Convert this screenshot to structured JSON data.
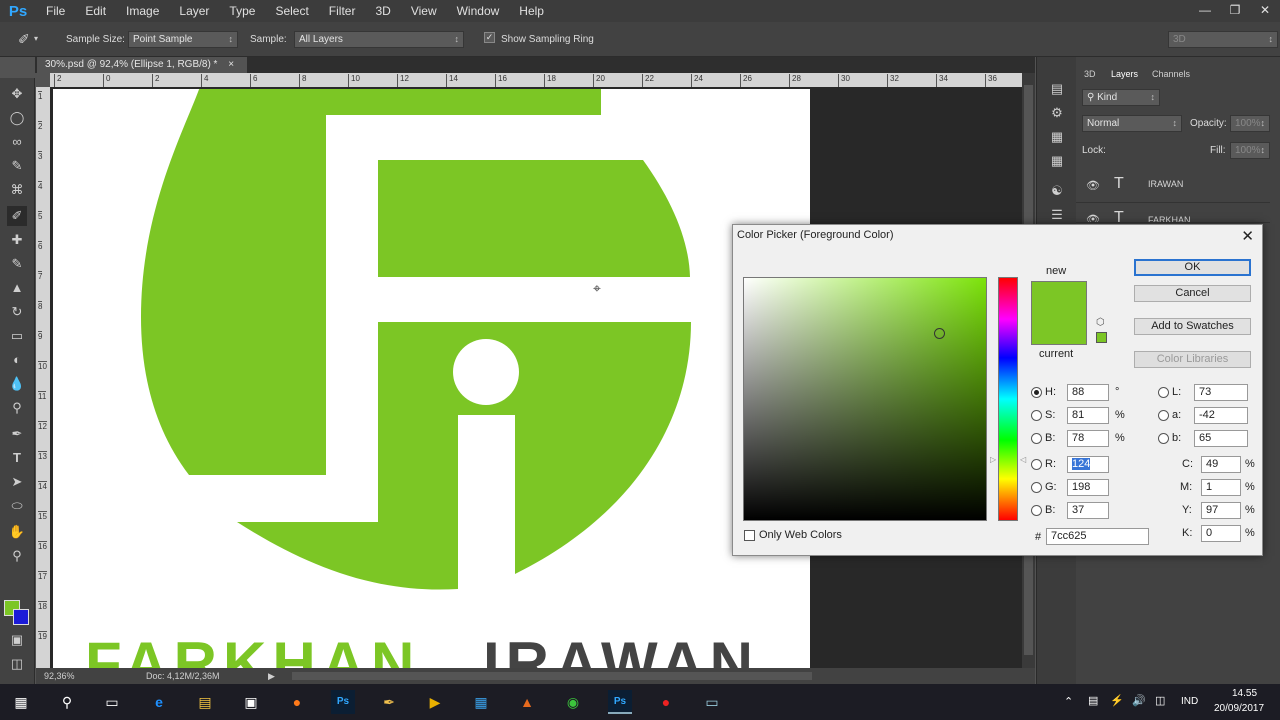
{
  "app": {
    "logo": "Ps"
  },
  "menu": [
    "File",
    "Edit",
    "Image",
    "Layer",
    "Type",
    "Select",
    "Filter",
    "3D",
    "View",
    "Window",
    "Help"
  ],
  "window_controls": {
    "minimize": "—",
    "restore": "❐",
    "close": "✕"
  },
  "options_bar": {
    "sample_size_label": "Sample Size:",
    "sample_size_value": "Point Sample",
    "sample_label": "Sample:",
    "sample_value": "All Layers",
    "sampling_ring_label": "Show Sampling Ring",
    "sampling_ring_checked": true,
    "workspace_value": "3D"
  },
  "document": {
    "tab_title": "30%.psd @ 92,4% (Ellipse 1, RGB/8) *",
    "tab_close": "×",
    "zoom": "92,36%",
    "doc_size": "Doc: 4,12M/2,36M",
    "logo_text_left": "FARKHAN",
    "logo_text_right": "IRAWAN",
    "logo_color": "#7cc625"
  },
  "ruler_h": [
    "2",
    "0",
    "2",
    "4",
    "6",
    "8",
    "10",
    "12",
    "14",
    "16",
    "18",
    "20",
    "22",
    "24",
    "26",
    "28",
    "30",
    "32",
    "34",
    "36",
    "38"
  ],
  "ruler_v": [
    "1",
    "2",
    "3",
    "4",
    "5",
    "6",
    "7",
    "8",
    "9",
    "10",
    "11",
    "12",
    "13",
    "14",
    "15",
    "16",
    "17",
    "18",
    "19"
  ],
  "layers_panel": {
    "tabs": [
      "3D",
      "Layers",
      "Channels"
    ],
    "active_tab": "Layers",
    "kind_label": "Kind",
    "blend_mode": "Normal",
    "opacity_label": "Opacity:",
    "opacity_value": "100%",
    "lock_label": "Lock:",
    "fill_label": "Fill:",
    "fill_value": "100%",
    "layers": [
      {
        "name": "IRAWAN",
        "type": "T"
      },
      {
        "name": "FARKHAN",
        "type": "T"
      }
    ]
  },
  "color_picker": {
    "title": "Color Picker (Foreground Color)",
    "new_label": "new",
    "current_label": "current",
    "new_color": "#7cc625",
    "current_color": "#7cc625",
    "ok": "OK",
    "cancel": "Cancel",
    "add_to_swatches": "Add to Swatches",
    "color_libraries": "Color Libraries",
    "only_web_colors": "Only Web Colors",
    "hex_prefix": "#",
    "hex": "7cc625",
    "hsb": {
      "H": "88",
      "S": "81",
      "B": "78",
      "H_unit": "°",
      "S_unit": "%",
      "B_unit": "%"
    },
    "rgb": {
      "R": "124",
      "G": "198",
      "B": "37"
    },
    "lab": {
      "L": "73",
      "a": "-42",
      "b": "65"
    },
    "cmyk": {
      "C": "49",
      "M": "1",
      "Y": "97",
      "K": "0",
      "unit": "%"
    },
    "labels": {
      "H": "H:",
      "S": "S:",
      "Bv": "B:",
      "R": "R:",
      "G": "G:",
      "Bb": "B:",
      "L": "L:",
      "a": "a:",
      "b": "b:",
      "C": "C:",
      "M": "M:",
      "Y": "Y:",
      "K": "K:"
    }
  },
  "taskbar": {
    "time": "14.55",
    "date": "20/09/2017",
    "language": "IND"
  }
}
